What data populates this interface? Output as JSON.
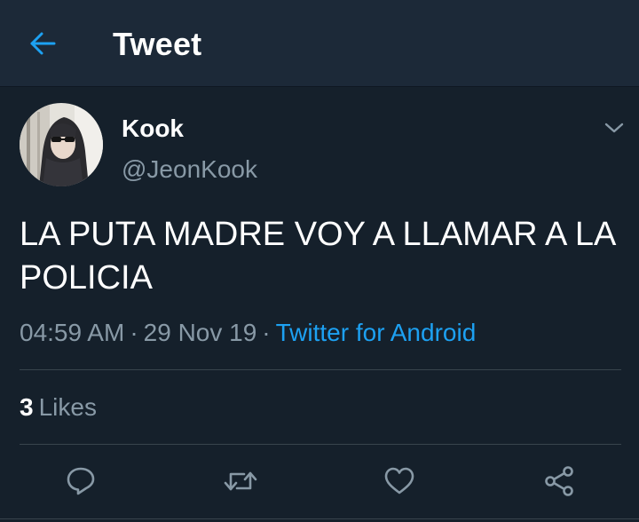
{
  "header": {
    "title": "Tweet",
    "back_icon": "arrow-left-icon"
  },
  "tweet": {
    "author": {
      "display_name": "Kook",
      "handle": "@JeonKook"
    },
    "text": "LA PUTA MADRE VOY A LLAMAR A LA POLICIA",
    "time": "04:59 AM",
    "date": "29 Nov 19",
    "separator": "·",
    "source": "Twitter for Android"
  },
  "stats": {
    "likes_count": "3",
    "likes_label": "Likes"
  },
  "actions": [
    "reply-icon",
    "retweet-icon",
    "like-icon",
    "share-icon"
  ],
  "colors": {
    "background": "#15202b",
    "header": "#1c2938",
    "accent": "#1da1f2",
    "secondary_text": "#8899a6",
    "divider": "#38444d"
  }
}
